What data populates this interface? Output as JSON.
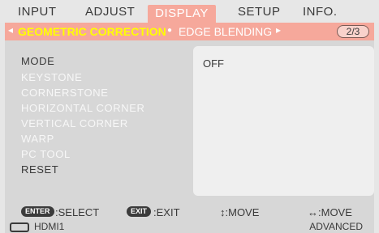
{
  "tabs": [
    {
      "label": "INPUT"
    },
    {
      "label": "ADJUST"
    },
    {
      "label": "DISPLAY",
      "active": true
    },
    {
      "label": "SETUP"
    },
    {
      "label": "INFO."
    }
  ],
  "submenu": {
    "active": "GEOMETRIC CORRECTION",
    "next": "EDGE BLENDING",
    "page": "2/3"
  },
  "items": [
    {
      "label": "MODE",
      "enabled": true
    },
    {
      "label": "KEYSTONE",
      "enabled": false
    },
    {
      "label": "CORNERSTONE",
      "enabled": false
    },
    {
      "label": "HORIZONTAL CORNER",
      "enabled": false
    },
    {
      "label": "VERTICAL CORNER",
      "enabled": false
    },
    {
      "label": "WARP",
      "enabled": false
    },
    {
      "label": "PC TOOL",
      "enabled": false
    },
    {
      "label": "RESET",
      "enabled": true
    }
  ],
  "value": "OFF",
  "footer": {
    "enter_key": "ENTER",
    "select": ":SELECT",
    "exit_key": "EXIT",
    "exit": ":EXIT",
    "move_vertical": "↕:MOVE",
    "move_horizontal": "↔:MOVE"
  },
  "status": {
    "input": "HDMI1",
    "mode": "ADVANCED"
  },
  "colors": {
    "accent": "#f6a89b",
    "active_text": "#ffff00",
    "enabled_text": "#3a3a3a",
    "disabled_text": "#f7f7f7"
  },
  "icons": {
    "left_arrow": "left-triangle-icon",
    "right_arrow": "right-triangle-icon",
    "input": "hdmi-connector-icon"
  }
}
